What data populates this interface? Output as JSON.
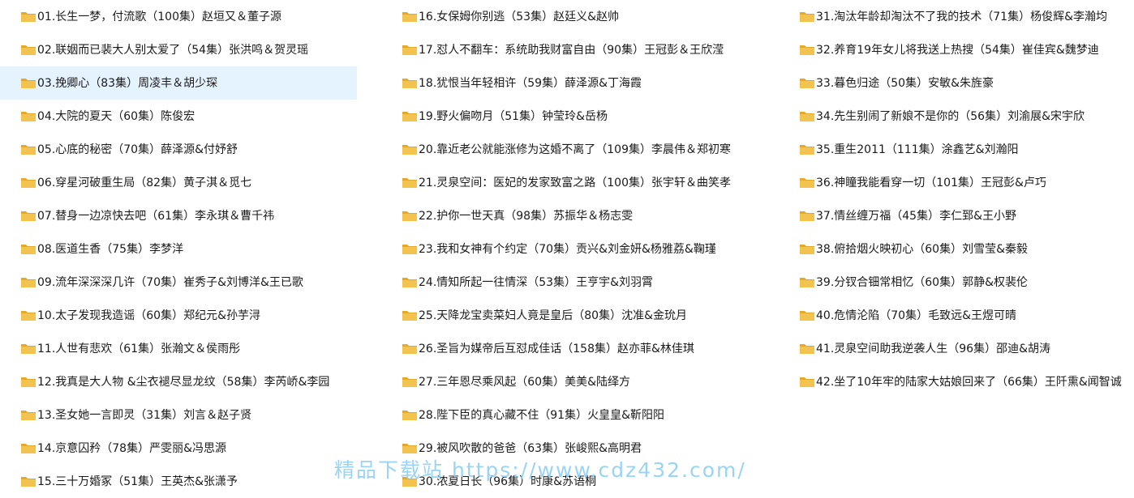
{
  "colors": {
    "folder_fill": "#f3c350",
    "folder_back": "#e4a92a",
    "selected_background": "#e5f3ff",
    "watermark": "#8fd0f5"
  },
  "selected_index": 2,
  "columns": [
    {
      "items": [
        "01.长生一梦，付流歌（100集）赵垣又＆董子源",
        "02.联姻而已裴大人别太爱了（54集）张洪鸣＆贺灵瑶",
        "03.挽卿心（83集）周凌丰＆胡少琛",
        "04.大院的夏天（60集）陈俊宏",
        "05.心底的秘密（70集）薛泽源&付妤舒",
        "06.穿星河破重生局（82集）黄子淇＆觅七",
        "07.替身一边凉快去吧（61集）李永琪＆曹千祎",
        "08.医道生香（75集）李梦洋",
        "09.流年深深深几许（70集）崔秀子&刘博洋&王已歌",
        "10.太子发现我造谣（60集）郑纪元&孙芋浔",
        "11.人世有悲欢（61集）张瀚文＆侯雨彤",
        "12.我真是大人物 &尘衣褪尽显龙纹（58集）李芮峤&李园",
        "13.圣女她一言即灵（31集）刘言＆赵子贤",
        "14.京意囚矜（78集）严雯丽&冯思源",
        "15.三十万婚冢（51集）王英杰&张潇予"
      ]
    },
    {
      "items": [
        "16.女保姆你别逃（53集）赵廷义&赵帅",
        "17.怼人不翻车：系统助我财富自由（90集）王冠彭＆王欣滢",
        "18.犹恨当年轻相许（59集）薛泽源&丁海霞",
        "19.野火偏吻月（51集）钟莹玲&岳杨",
        "20.靠近老公就能涨修为这婚不离了（109集）李晨伟＆郑初寒",
        "21.灵泉空间：医妃的发家致富之路（100集）张宇轩＆曲笑孝",
        "22.护你一世天真（98集）苏振华＆杨志雯",
        "23.我和女神有个约定（70集）贡兴&刘金妍&杨雅荔&鞠瑾",
        "24.情知所起一往情深（53集）王亨宇&刘羽霄",
        "25.天降龙宝卖菜妇人竟是皇后（80集）沈准&金玧月",
        "26.圣旨为媒帝后互怼成佳话（158集）赵亦菲&林佳琪",
        "27.三年恩尽乘风起（60集）美美&陆绎方",
        "28.陛下臣的真心藏不住（91集）火皇皇&靳阳阳",
        "29.被风吹散的爸爸（63集）张峻熙&高明君",
        "30.浓夏日长（96集）时康&苏语桐"
      ]
    },
    {
      "items": [
        "31.淘汰年龄却淘汰不了我的技术（71集）杨俊辉&李瀚均",
        "32.养育19年女儿将我送上热搜（54集）崔佳宾&魏梦迪",
        "33.暮色归途（50集）安敏&朱旌豪",
        "34.先生别闹了新娘不是你的（56集）刘渝展&宋宇欣",
        "35.重生2011（111集）涂鑫艺&刘瀚阳",
        "36.神瞳我能看穿一切（101集）王冠彭&卢巧",
        "37.情丝缠万福（45集）李仁郅&王小野",
        "38.俯拾烟火映初心（60集）刘雪莹&秦毅",
        "39.分钗合钿常相忆（60集）郭静&权裴伦",
        "40.危情沦陷（70集）毛致远&王煜可晴",
        "41.灵泉空间助我逆袭人生（96集）邵迪&胡涛",
        "42.坐了10年牢的陆家大姑娘回来了（66集）王阡熏&闻智诚"
      ]
    }
  ],
  "watermark": "精品下载站  https://www.cdz432.com/"
}
